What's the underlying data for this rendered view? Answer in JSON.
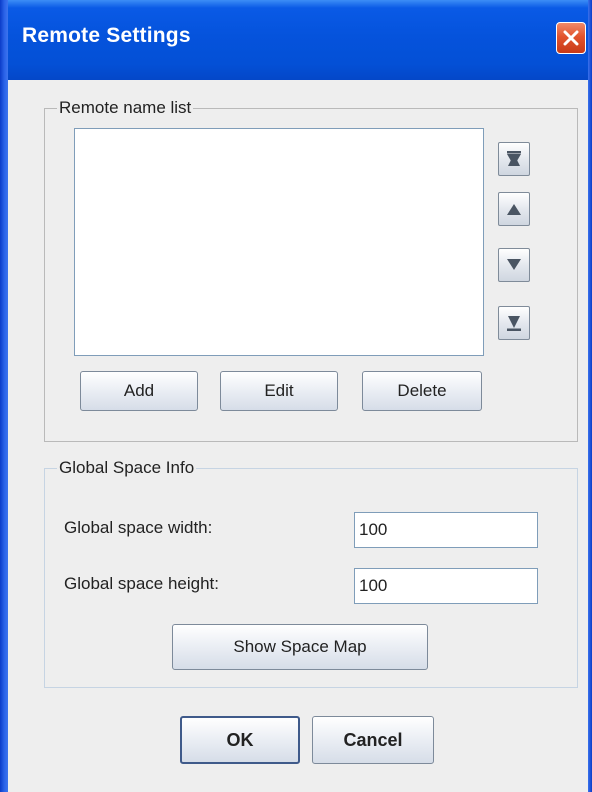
{
  "window": {
    "title": "Remote Settings"
  },
  "remote_group": {
    "legend": "Remote name list",
    "items": [],
    "move_buttons": [
      {
        "icon": "move-to-top-icon"
      },
      {
        "icon": "move-up-icon"
      },
      {
        "icon": "move-down-icon"
      },
      {
        "icon": "move-to-bottom-icon"
      }
    ],
    "add_label": "Add",
    "edit_label": "Edit",
    "delete_label": "Delete"
  },
  "global_group": {
    "legend": "Global Space Info",
    "width_label": "Global space width:",
    "width_value": "100",
    "height_label": "Global space height:",
    "height_value": "100",
    "show_map_label": "Show Space Map"
  },
  "footer": {
    "ok_label": "OK",
    "cancel_label": "Cancel"
  },
  "colors": {
    "titlebar": "#0553dc",
    "close": "#e2542e",
    "background": "#eeeeee",
    "list_border": "#7f9db9"
  }
}
